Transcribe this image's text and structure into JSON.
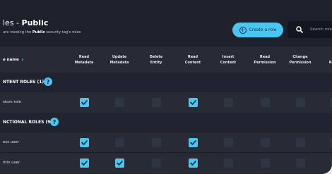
{
  "header": {
    "title_prefix": "les - ",
    "title_name": "Public",
    "subtitle_start": " are viewing the ",
    "subtitle_tag": "Public",
    "subtitle_end": " security tag's roles"
  },
  "toolbar": {
    "create_label": "Create a role",
    "search_placeholder": "Search role"
  },
  "table": {
    "name_header": "e name",
    "columns": [
      {
        "l1": "Read",
        "l2": "Metadata"
      },
      {
        "l1": "Update",
        "l2": "Metadata"
      },
      {
        "l1": "Delete",
        "l2": "Entity"
      },
      {
        "l1": "Read",
        "l2": "Content"
      },
      {
        "l1": "Insert",
        "l2": "Content"
      },
      {
        "l1": "Read",
        "l2": "Permission"
      },
      {
        "l1": "Change",
        "l2": "Permission"
      },
      {
        "l1": "C",
        "l2": "Reten"
      }
    ],
    "sections": [
      {
        "label": "NTENT ROLES (1)",
        "rows": [
          {
            "name": "stom role",
            "checks": [
              true,
              false,
              false,
              true,
              false,
              false,
              false,
              false
            ]
          }
        ]
      },
      {
        "label": "NCTIONAL ROLES (9)",
        "rows": [
          {
            "name": "ess user",
            "checks": [
              true,
              false,
              false,
              true,
              false,
              false,
              false,
              false
            ]
          },
          {
            "name": "min user",
            "checks": [
              true,
              true,
              false,
              true,
              false,
              false,
              false,
              false
            ]
          }
        ]
      }
    ]
  },
  "colors": {
    "accent": "#4cc6f0",
    "background": "#1f2430",
    "row": "#262b36"
  },
  "icons": {
    "create": "plus-circle-icon",
    "search": "search-icon",
    "help": "help-circle-icon",
    "sort": "sort-down-arrow-icon",
    "check": "check-icon"
  }
}
